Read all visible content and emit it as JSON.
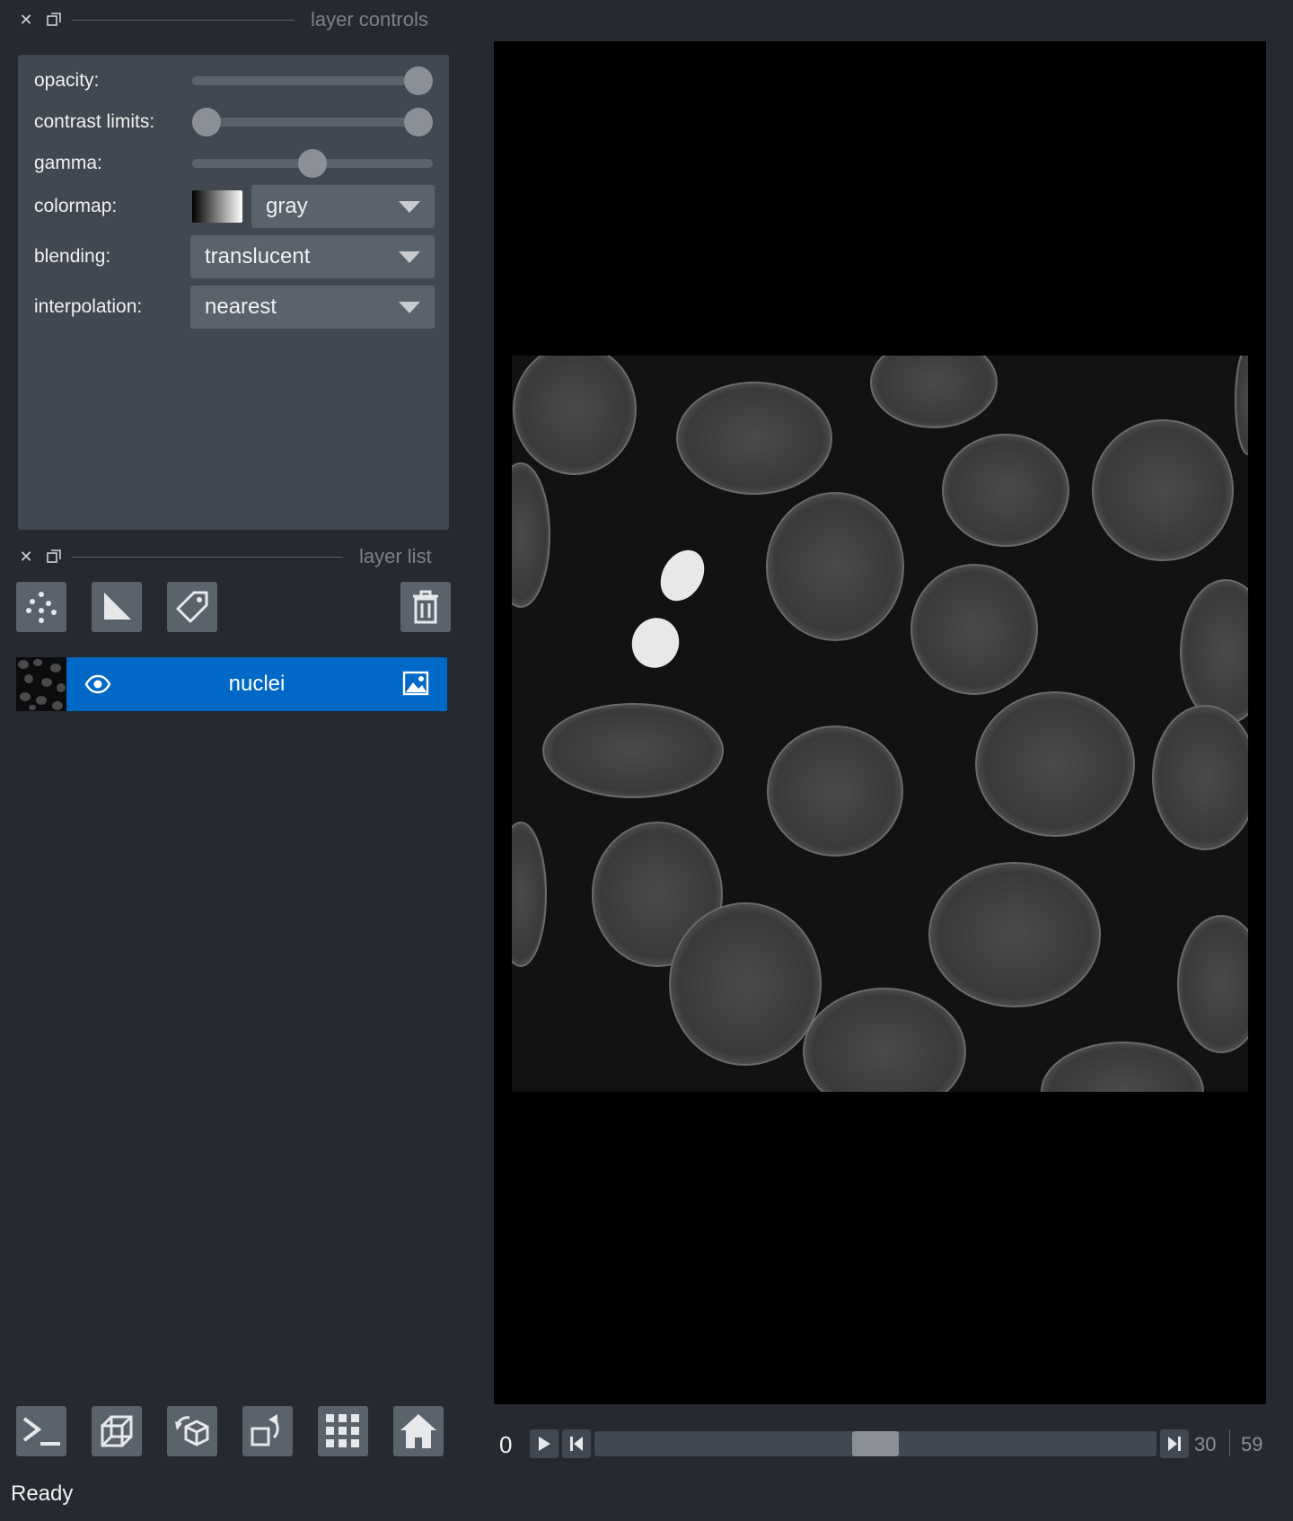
{
  "layer_controls": {
    "title": "layer controls",
    "opacity": {
      "label": "opacity:",
      "value": 1.0
    },
    "contrast_limits": {
      "label": "contrast limits:",
      "min": 0.0,
      "max": 1.0
    },
    "gamma": {
      "label": "gamma:",
      "value": 0.5
    },
    "colormap": {
      "label": "colormap:",
      "value": "gray"
    },
    "blending": {
      "label": "blending:",
      "value": "translucent"
    },
    "interpolation": {
      "label": "interpolation:",
      "value": "nearest"
    }
  },
  "layer_list": {
    "title": "layer list",
    "layers": [
      {
        "name": "nuclei",
        "visible": true,
        "type": "image"
      }
    ]
  },
  "dims": {
    "start": "0",
    "current": "30",
    "max": "59",
    "position_fraction": 0.5
  },
  "status": "Ready",
  "colors": {
    "background": "#262930",
    "panel": "#414851",
    "button": "#5a626c",
    "selected_layer": "#0068c7"
  }
}
